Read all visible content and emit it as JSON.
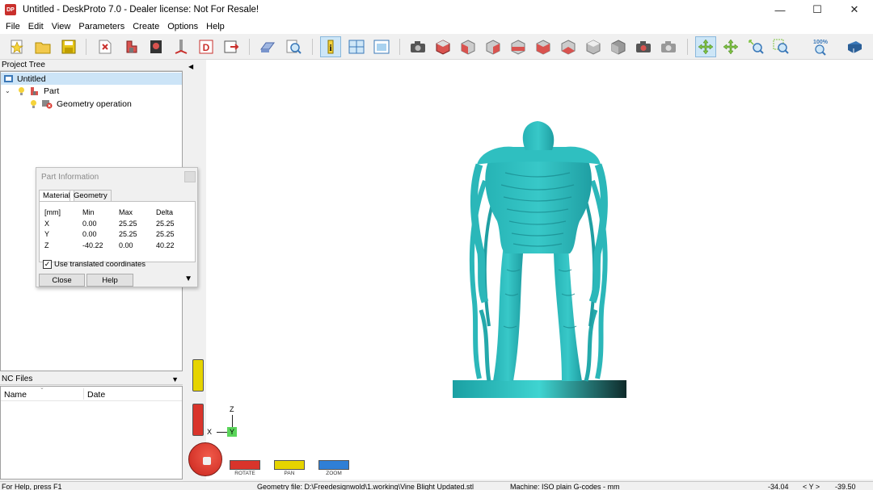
{
  "window": {
    "title": "Untitled - DeskProto 7.0 - Dealer license: Not For Resale!",
    "logo_text": "DP",
    "controls": {
      "minimize": "—",
      "maximize": "☐",
      "close": "✕"
    }
  },
  "menu": [
    "File",
    "Edit",
    "View",
    "Parameters",
    "Create",
    "Options",
    "Help"
  ],
  "toolbar": {
    "zoom_label": "100%"
  },
  "project_tree": {
    "header": "Project Tree",
    "items": [
      {
        "label": "Untitled",
        "icon": "project-icon"
      },
      {
        "label": "Part",
        "icon": "part-icon"
      },
      {
        "label": "Geometry operation",
        "icon": "geometry-operation-icon"
      }
    ]
  },
  "nc_files": {
    "header": "NC Files",
    "columns": [
      "Name",
      "Date"
    ]
  },
  "part_information": {
    "title": "Part Information",
    "tabs": [
      "Material",
      "Geometry"
    ],
    "table": {
      "headers": [
        "[mm]",
        "Min",
        "Max",
        "Delta"
      ],
      "rows": [
        [
          "X",
          "0.00",
          "25.25",
          "25.25"
        ],
        [
          "Y",
          "0.00",
          "25.25",
          "25.25"
        ],
        [
          "Z",
          "-40.22",
          "0.00",
          "40.22"
        ]
      ]
    },
    "checkbox_label": "Use translated coordinates",
    "checkbox_checked": true,
    "close_label": "Close",
    "help_label": "Help"
  },
  "axes": {
    "z": "Z",
    "x": "X",
    "y": "Y"
  },
  "bottom_controls": [
    {
      "label": "ROTATE",
      "color": "#d9342b"
    },
    {
      "label": "PAN",
      "color": "#e6d400"
    },
    {
      "label": "ZOOM",
      "color": "#2f7fd6"
    }
  ],
  "status": {
    "help": "For Help, press F1",
    "geometry_file": "Geometry file: D:\\Freedesignwold\\1.working\\Vine Blight Updated.stl",
    "machine": "Machine: ISO plain G-codes - mm",
    "coord_x": "-34.04",
    "coord_sep": "< Y >",
    "coord_y": "-39.50"
  },
  "colors": {
    "model": "#33c4c4",
    "model_shadow": "#1a9a9e",
    "selection": "#cce4f7"
  }
}
